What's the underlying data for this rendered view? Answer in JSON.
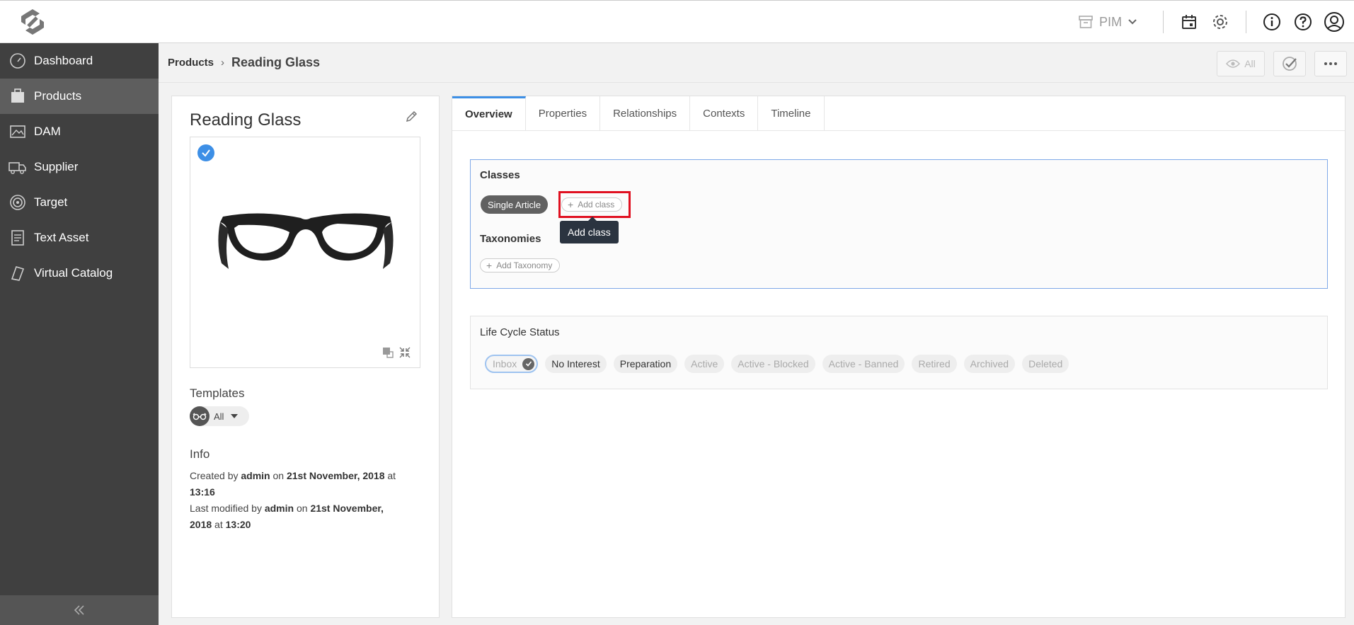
{
  "topbar": {
    "module_label": "PIM"
  },
  "sidebar": {
    "items": [
      {
        "label": "Dashboard",
        "icon": "gauge-icon"
      },
      {
        "label": "Products",
        "icon": "box-icon"
      },
      {
        "label": "DAM",
        "icon": "image-icon"
      },
      {
        "label": "Supplier",
        "icon": "truck-icon"
      },
      {
        "label": "Target",
        "icon": "target-icon"
      },
      {
        "label": "Text Asset",
        "icon": "document-icon"
      },
      {
        "label": "Virtual Catalog",
        "icon": "book-icon"
      }
    ],
    "active_index": 1
  },
  "breadcrumb": {
    "parent": "Products",
    "current": "Reading Glass",
    "view_label": "All"
  },
  "product": {
    "title": "Reading Glass",
    "templates_label": "Templates",
    "template_value": "All",
    "info_label": "Info",
    "created_prefix": "Created by",
    "created_user": "admin",
    "on_word": "on",
    "created_date": "21st November, 2018",
    "at_word": "at",
    "created_time": "13:16",
    "modified_prefix": "Last modified by",
    "modified_user": "admin",
    "modified_date": "21st November, 2018",
    "modified_time": "13:20"
  },
  "tabs": [
    "Overview",
    "Properties",
    "Relationships",
    "Contexts",
    "Timeline"
  ],
  "overview": {
    "classes_label": "Classes",
    "class_chip": "Single Article",
    "add_class_label": "Add class",
    "tooltip": "Add class",
    "taxonomies_label": "Taxonomies",
    "add_taxonomy_label": "Add Taxonomy",
    "lifecycle_label": "Life Cycle Status",
    "statuses": [
      "Inbox",
      "No Interest",
      "Preparation",
      "Active",
      "Active - Blocked",
      "Active - Banned",
      "Retired",
      "Archived",
      "Deleted"
    ]
  },
  "colors": {
    "accent": "#3d8fe6",
    "sidebar_bg": "#404040",
    "highlight": "#e01020"
  }
}
